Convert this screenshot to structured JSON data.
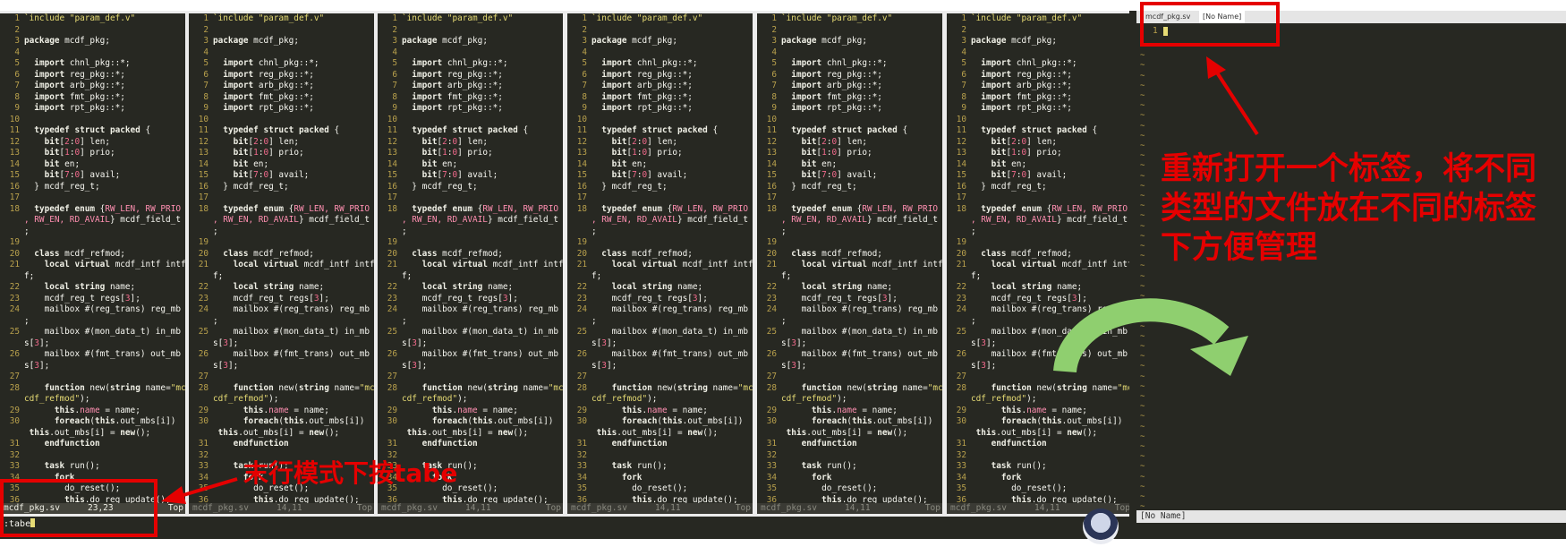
{
  "code_lines": [
    {
      "n": "1",
      "html": "<span class=\"str\">`include \"param_def.v\"</span>"
    },
    {
      "n": "2",
      "html": ""
    },
    {
      "n": "3",
      "html": "<span class=\"kw\">package</span> mcdf_pkg;"
    },
    {
      "n": "4",
      "html": ""
    },
    {
      "n": "5",
      "html": "  <span class=\"kw\">import</span> chnl_pkg::*;"
    },
    {
      "n": "6",
      "html": "  <span class=\"kw\">import</span> reg_pkg::*;"
    },
    {
      "n": "7",
      "html": "  <span class=\"kw\">import</span> arb_pkg::*;"
    },
    {
      "n": "8",
      "html": "  <span class=\"kw\">import</span> fmt_pkg::*;"
    },
    {
      "n": "9",
      "html": "  <span class=\"kw\">import</span> rpt_pkg::*;"
    },
    {
      "n": "10",
      "html": ""
    },
    {
      "n": "11",
      "html": "  <span class=\"kw\">typedef struct packed</span> {"
    },
    {
      "n": "12",
      "html": "    <span class=\"kw\">bit</span>[<span class=\"num\">2</span>:<span class=\"num\">0</span>] len;"
    },
    {
      "n": "13",
      "html": "    <span class=\"kw\">bit</span>[<span class=\"num\">1</span>:<span class=\"num\">0</span>] prio;"
    },
    {
      "n": "14",
      "html": "    <span class=\"kw\">bit</span> en;"
    },
    {
      "n": "15",
      "html": "    <span class=\"kw\">bit</span>[<span class=\"num\">7</span>:<span class=\"num\">0</span>] avail;"
    },
    {
      "n": "16",
      "html": "  } mcdf_reg_t;"
    },
    {
      "n": "17",
      "html": ""
    },
    {
      "n": "18",
      "html": "  <span class=\"kw\">typedef enum</span> {<span class=\"tp\">RW_LEN, RW_PRIO</span>"
    },
    {
      "n": "",
      "html": "<span class=\"tp\">, RW_EN, RD_AVAIL</span>} mcdf_field_t"
    },
    {
      "n": "",
      "html": ";"
    },
    {
      "n": "19",
      "html": ""
    },
    {
      "n": "20",
      "html": "  <span class=\"kw\">class</span> mcdf_refmod;"
    },
    {
      "n": "21",
      "html": "    <span class=\"kw\">local virtual</span> mcdf_intf intf"
    },
    {
      "n": "",
      "html": "f;"
    },
    {
      "n": "22",
      "html": "    <span class=\"kw\">local string</span> name;"
    },
    {
      "n": "23",
      "html": "    mcdf_reg_t regs[<span class=\"num\">3</span>];"
    },
    {
      "n": "24",
      "html": "    mailbox #(reg_trans) reg_mb"
    },
    {
      "n": "",
      "html": ";"
    },
    {
      "n": "25",
      "html": "    mailbox #(mon_data_t) in_mb"
    },
    {
      "n": "",
      "html": "s[<span class=\"num\">3</span>];"
    },
    {
      "n": "26",
      "html": "    mailbox #(fmt_trans) out_mb"
    },
    {
      "n": "",
      "html": "s[<span class=\"num\">3</span>];"
    },
    {
      "n": "27",
      "html": ""
    },
    {
      "n": "28",
      "html": "    <span class=\"kw\">function</span> new(<span class=\"kw\">string</span> name=<span class=\"str\">\"mcdf_refmod\"</span>);"
    },
    {
      "n": "",
      "html": "<span class=\"str\">cdf_refmod\"</span>);"
    },
    {
      "n": "29",
      "html": "      <span class=\"kw\">this</span>.<span class=\"tp\">name</span> = name;"
    },
    {
      "n": "30",
      "html": "      <span class=\"kw\">foreach</span>(<span class=\"kw\">this</span>.out_mbs[i])"
    },
    {
      "n": "",
      "html": " <span class=\"kw\">this</span>.out_mbs[i] = <span class=\"kw\">new</span>();"
    },
    {
      "n": "31",
      "html": "    <span class=\"kw\">endfunction</span>"
    },
    {
      "n": "32",
      "html": ""
    },
    {
      "n": "33",
      "html": "    <span class=\"kw\">task</span> run();"
    },
    {
      "n": "34",
      "html": "      <span class=\"kw\">fork</span>"
    },
    {
      "n": "35",
      "html": "        do_reset();"
    },
    {
      "n": "36",
      "html": "        <span class=\"kw\">this</span>.do_reg_update();"
    }
  ],
  "panes": [
    {
      "status_file": "mcdf_pkg.sv",
      "status_pos": "23,23",
      "status_top": "Top",
      "active": true
    },
    {
      "status_file": "mcdf_pkg.sv",
      "status_pos": "14,11",
      "status_top": "Top",
      "active": false
    },
    {
      "status_file": "mcdf_pkg.sv",
      "status_pos": "14,11",
      "status_top": "Top",
      "active": false
    },
    {
      "status_file": "mcdf_pkg.sv",
      "status_pos": "14,11",
      "status_top": "Top",
      "active": false
    },
    {
      "status_file": "mcdf_pkg.sv",
      "status_pos": "14,11",
      "status_top": "Top",
      "active": false
    },
    {
      "status_file": "mcdf_pkg.sv",
      "status_pos": "14,11",
      "status_top": "Top",
      "active": false
    }
  ],
  "cmdline": ":tabe",
  "right": {
    "tabs": [
      "mcdf_pkg.sv",
      "[No Name]"
    ],
    "line_number": "1",
    "status": "[No Name]"
  },
  "annotations": {
    "right_text": "重新打开一个标签，将不同类型的文件放在不同的标签下方便管理",
    "bottom_text": "末行模式下按tabe"
  },
  "colors": {
    "annotation_red": "#e50000",
    "arrow_green": "#8fcf6f",
    "vim_bg": "#272822"
  }
}
